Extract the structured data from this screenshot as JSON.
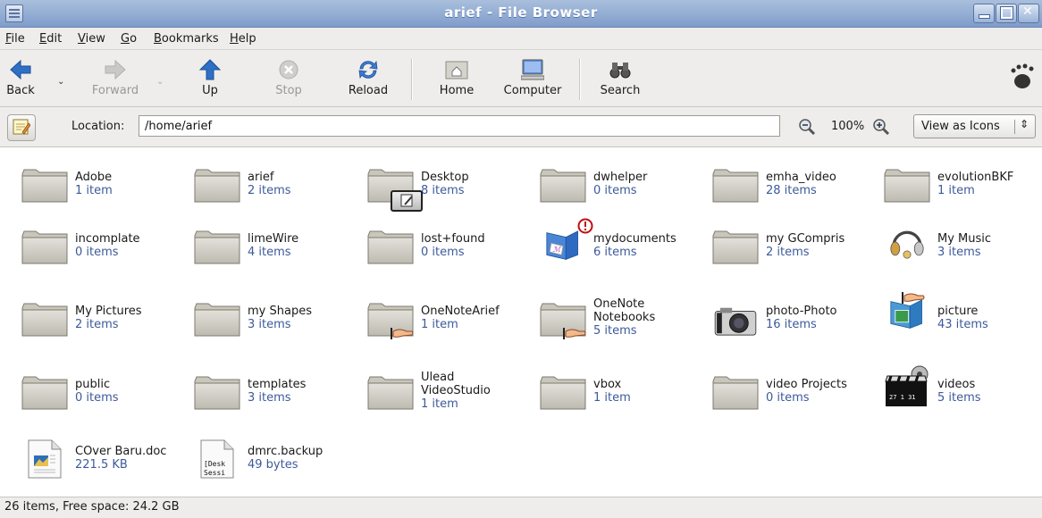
{
  "window": {
    "title": "arief - File Browser"
  },
  "menu": [
    "File",
    "Edit",
    "View",
    "Go",
    "Bookmarks",
    "Help"
  ],
  "toolbar": {
    "back": "Back",
    "forward": "Forward",
    "up": "Up",
    "stop": "Stop",
    "reload": "Reload",
    "home": "Home",
    "computer": "Computer",
    "search": "Search"
  },
  "location": {
    "label": "Location:",
    "value": "/home/arief",
    "zoom": "100%",
    "view": "View as Icons"
  },
  "items": [
    {
      "name": "Adobe",
      "count": "1 item",
      "icon": "folder-icon"
    },
    {
      "name": "arief",
      "count": "2 items",
      "icon": "folder-icon"
    },
    {
      "name": "Desktop",
      "count": "8 items",
      "icon": "folder-icon"
    },
    {
      "name": "dwhelper",
      "count": "0 items",
      "icon": "folder-icon"
    },
    {
      "name": "emha_video",
      "count": "28 items",
      "icon": "folder-icon"
    },
    {
      "name": "evolutionBKF",
      "count": "1 item",
      "icon": "folder-icon"
    },
    {
      "name": "incomplate",
      "count": "0 items",
      "icon": "folder-icon"
    },
    {
      "name": "limeWire",
      "count": "4 items",
      "icon": "folder-icon"
    },
    {
      "name": "lost+found",
      "count": "0 items",
      "icon": "folder-icon"
    },
    {
      "name": "mydocuments",
      "count": "6 items",
      "icon": "documents-folder-icon"
    },
    {
      "name": "my GCompris",
      "count": "2 items",
      "icon": "folder-icon"
    },
    {
      "name": "My Music",
      "count": "3 items",
      "icon": "music-headphones-icon"
    },
    {
      "name": "My Pictures",
      "count": "2 items",
      "icon": "folder-icon"
    },
    {
      "name": "my Shapes",
      "count": "3 items",
      "icon": "folder-icon"
    },
    {
      "name": "OneNoteArief",
      "count": "1 item",
      "icon": "shared-folder-icon"
    },
    {
      "name": "OneNote\nNotebooks",
      "count": "5 items",
      "icon": "shared-folder-icon"
    },
    {
      "name": "photo-Photo",
      "count": "16 items",
      "icon": "camera-icon"
    },
    {
      "name": "picture",
      "count": "43 items",
      "icon": "pictures-folder-icon"
    },
    {
      "name": "public",
      "count": "0 items",
      "icon": "folder-icon"
    },
    {
      "name": "templates",
      "count": "3 items",
      "icon": "folder-icon"
    },
    {
      "name": "Ulead\nVideoStudio",
      "count": "1 item",
      "icon": "folder-icon"
    },
    {
      "name": "vbox",
      "count": "1 item",
      "icon": "folder-icon"
    },
    {
      "name": "video Projects",
      "count": "0 items",
      "icon": "folder-icon"
    },
    {
      "name": "videos",
      "count": "5 items",
      "icon": "film-clapper-icon"
    },
    {
      "name": "COver Baru.doc",
      "count": "221.5 KB",
      "icon": "document-icon"
    },
    {
      "name": "dmrc.backup",
      "count": "49 bytes",
      "icon": "text-file-icon",
      "preview": "[Desk\nSessi"
    }
  ],
  "status": {
    "text": "26 items, Free space: 24.2 GB"
  }
}
